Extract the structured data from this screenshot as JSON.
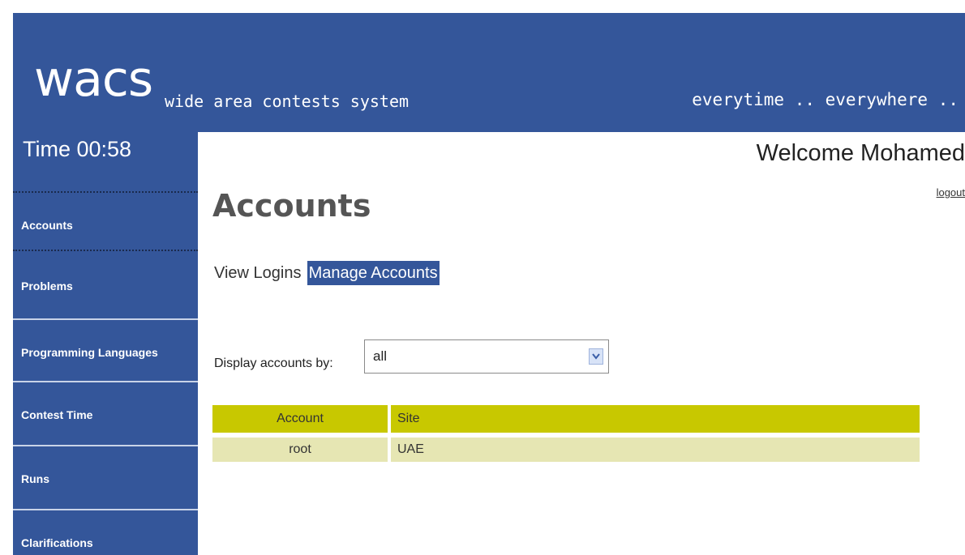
{
  "header": {
    "logo": "wacs",
    "tagline": "wide area contests system",
    "motto": "everytime .. everywhere .."
  },
  "sidebar": {
    "timer": "Time 00:58",
    "items": [
      {
        "label": "Accounts"
      },
      {
        "label": "Problems"
      },
      {
        "label": "Programming Languages"
      },
      {
        "label": "Contest Time"
      },
      {
        "label": "Runs"
      },
      {
        "label": "Clarifications"
      }
    ]
  },
  "user": {
    "welcome": "Welcome Mohamed",
    "logout": "logout"
  },
  "main": {
    "title": "Accounts",
    "tabs": [
      {
        "label": "View Logins"
      },
      {
        "label": "Manage Accounts"
      }
    ],
    "filter": {
      "label": "Display accounts by:",
      "value": "all"
    },
    "table": {
      "headers": [
        "Account",
        "Site"
      ],
      "rows": [
        [
          "root",
          "UAE"
        ]
      ]
    }
  },
  "colors": {
    "brand": "#34569a",
    "table_header": "#c8c800",
    "table_row": "#e6e6b3"
  }
}
